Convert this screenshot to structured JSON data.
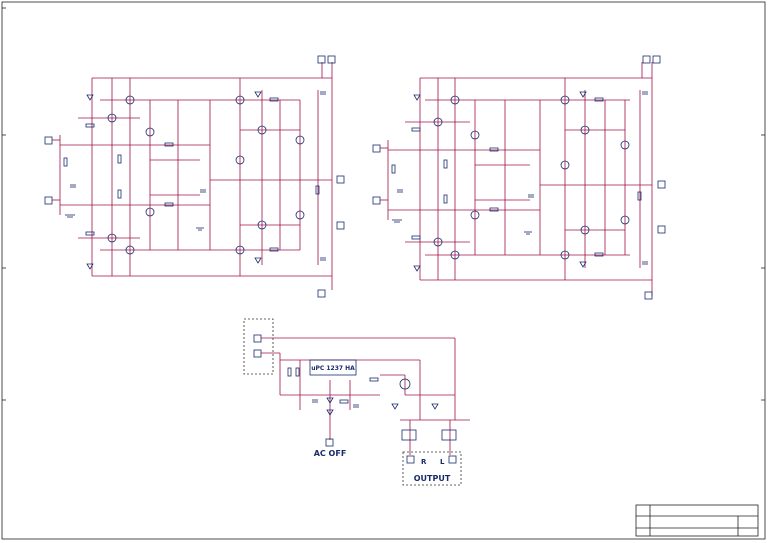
{
  "labels": {
    "ac_off": "AC OFF",
    "output": "OUTPUT",
    "right_channel": "R",
    "left_channel": "L",
    "relay_ic": "uPC 1237 HA"
  },
  "colors": {
    "wire": "#a0104a",
    "component": "#1a2b6b",
    "background": "#ffffff",
    "frame": "#222222"
  }
}
